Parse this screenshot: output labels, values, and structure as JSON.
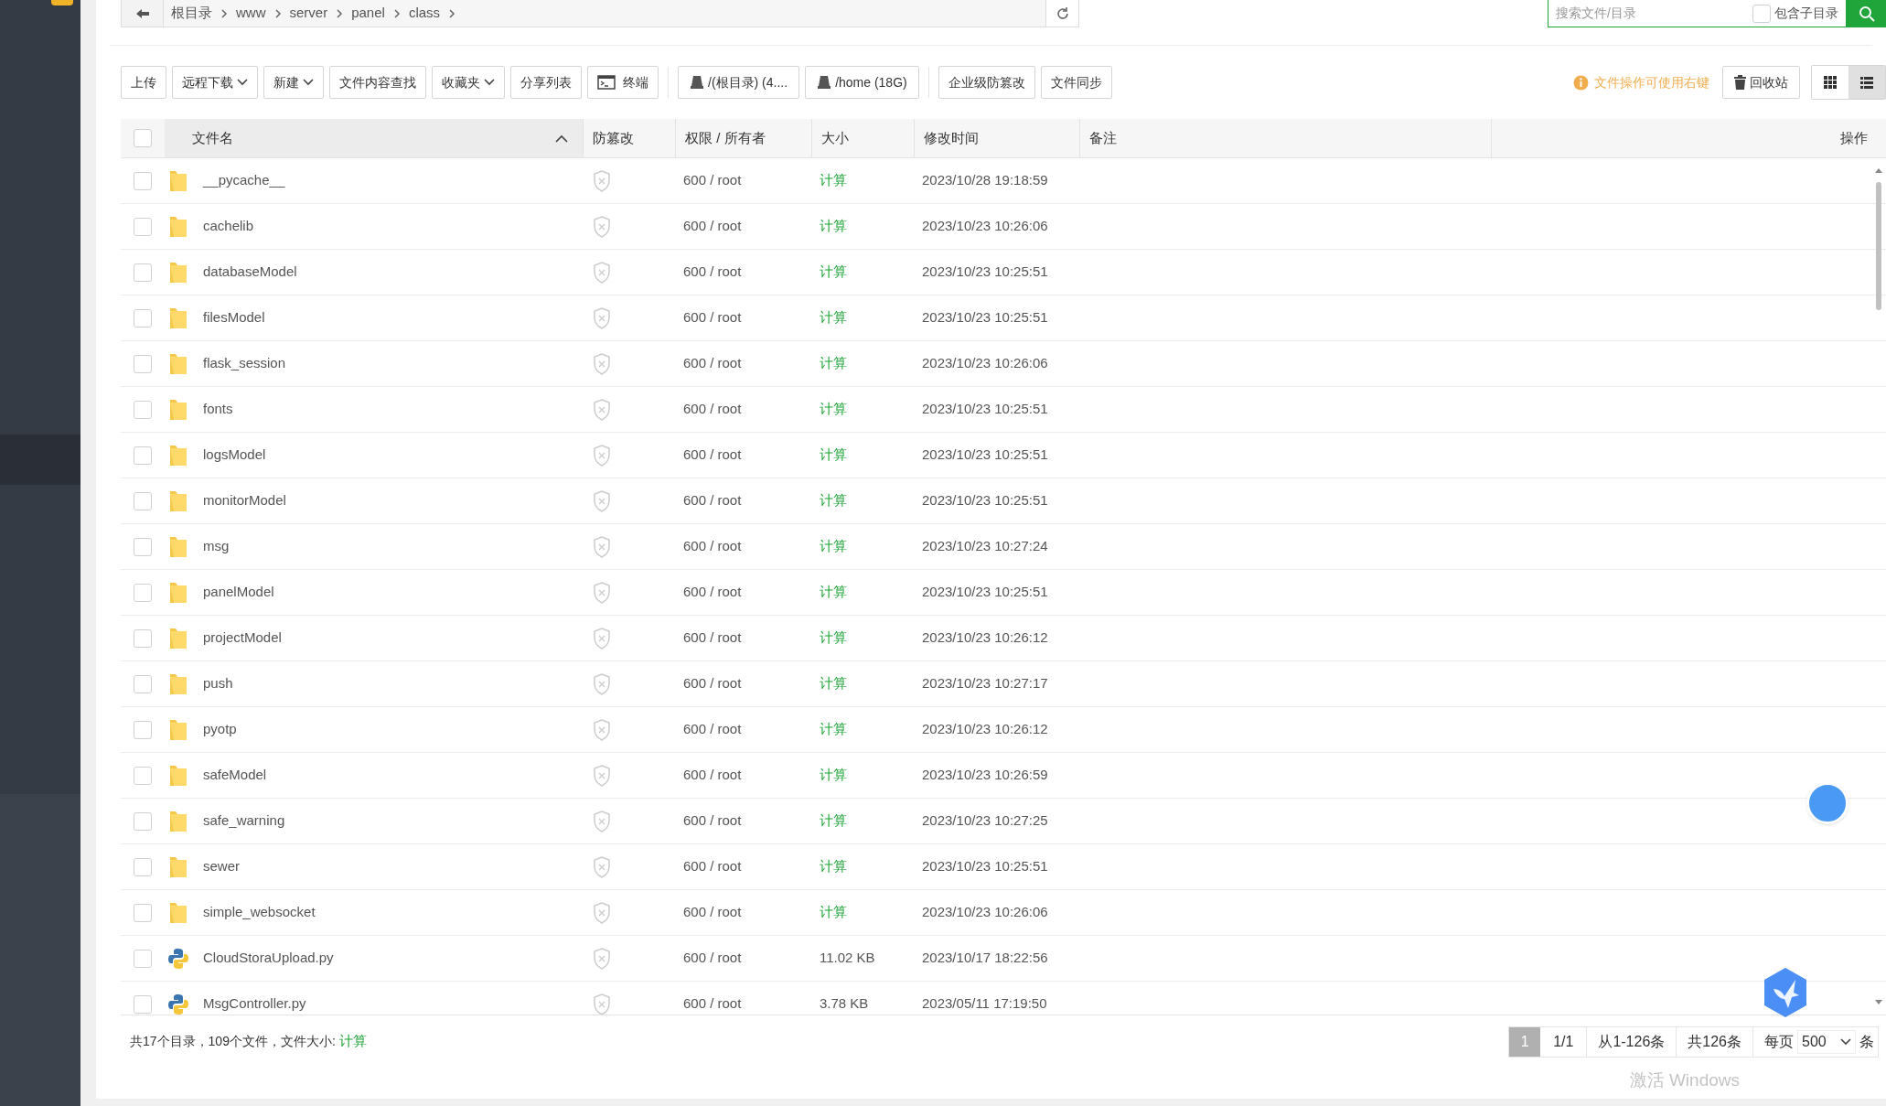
{
  "breadcrumb": [
    "根目录",
    "www",
    "server",
    "panel",
    "class"
  ],
  "search": {
    "placeholder": "搜索文件/目录",
    "include_sub": {
      "label": "包含子目录",
      "checked": false
    }
  },
  "toolbar": [
    {
      "label": "上传",
      "kind": "plain"
    },
    {
      "label": "远程下载",
      "kind": "dropdown"
    },
    {
      "label": "新建",
      "kind": "dropdown"
    },
    {
      "label": "文件内容查找",
      "kind": "plain"
    },
    {
      "label": "收藏夹",
      "kind": "dropdown"
    },
    {
      "label": "分享列表",
      "kind": "plain"
    },
    {
      "label": "终端",
      "kind": "terminal"
    },
    {
      "label": "/(根目录) (4....",
      "kind": "disk"
    },
    {
      "label": "/home (18G)",
      "kind": "disk"
    },
    {
      "label": "企业级防篡改",
      "kind": "plain"
    },
    {
      "label": "文件同步",
      "kind": "plain"
    }
  ],
  "hint": "文件操作可使用右键",
  "recycle": "回收站",
  "views": [
    {
      "kind": "grid",
      "selected": false
    },
    {
      "kind": "list",
      "selected": true
    }
  ],
  "table": {
    "select_all_checked": false,
    "columns": [
      "文件名",
      "防篡改",
      "权限 / 所有者",
      "大小",
      "修改时间",
      "备注",
      "操作"
    ],
    "rows": [
      {
        "name": "__pycache__",
        "kind": "folder",
        "checked": false,
        "perm": "600 / root",
        "size": "计算",
        "mtime": "2023/10/28 19:18:59"
      },
      {
        "name": "cachelib",
        "kind": "folder",
        "checked": false,
        "perm": "600 / root",
        "size": "计算",
        "mtime": "2023/10/23 10:26:06"
      },
      {
        "name": "databaseModel",
        "kind": "folder",
        "checked": false,
        "perm": "600 / root",
        "size": "计算",
        "mtime": "2023/10/23 10:25:51"
      },
      {
        "name": "filesModel",
        "kind": "folder",
        "checked": false,
        "perm": "600 / root",
        "size": "计算",
        "mtime": "2023/10/23 10:25:51"
      },
      {
        "name": "flask_session",
        "kind": "folder",
        "checked": false,
        "perm": "600 / root",
        "size": "计算",
        "mtime": "2023/10/23 10:26:06"
      },
      {
        "name": "fonts",
        "kind": "folder",
        "checked": false,
        "perm": "600 / root",
        "size": "计算",
        "mtime": "2023/10/23 10:25:51"
      },
      {
        "name": "logsModel",
        "kind": "folder",
        "checked": false,
        "perm": "600 / root",
        "size": "计算",
        "mtime": "2023/10/23 10:25:51"
      },
      {
        "name": "monitorModel",
        "kind": "folder",
        "checked": false,
        "perm": "600 / root",
        "size": "计算",
        "mtime": "2023/10/23 10:25:51"
      },
      {
        "name": "msg",
        "kind": "folder",
        "checked": false,
        "perm": "600 / root",
        "size": "计算",
        "mtime": "2023/10/23 10:27:24"
      },
      {
        "name": "panelModel",
        "kind": "folder",
        "checked": false,
        "perm": "600 / root",
        "size": "计算",
        "mtime": "2023/10/23 10:25:51"
      },
      {
        "name": "projectModel",
        "kind": "folder",
        "checked": false,
        "perm": "600 / root",
        "size": "计算",
        "mtime": "2023/10/23 10:26:12"
      },
      {
        "name": "push",
        "kind": "folder",
        "checked": false,
        "perm": "600 / root",
        "size": "计算",
        "mtime": "2023/10/23 10:27:17"
      },
      {
        "name": "pyotp",
        "kind": "folder",
        "checked": false,
        "perm": "600 / root",
        "size": "计算",
        "mtime": "2023/10/23 10:26:12"
      },
      {
        "name": "safeModel",
        "kind": "folder",
        "checked": false,
        "perm": "600 / root",
        "size": "计算",
        "mtime": "2023/10/23 10:26:59"
      },
      {
        "name": "safe_warning",
        "kind": "folder",
        "checked": false,
        "perm": "600 / root",
        "size": "计算",
        "mtime": "2023/10/23 10:27:25"
      },
      {
        "name": "sewer",
        "kind": "folder",
        "checked": false,
        "perm": "600 / root",
        "size": "计算",
        "mtime": "2023/10/23 10:25:51"
      },
      {
        "name": "simple_websocket",
        "kind": "folder",
        "checked": false,
        "perm": "600 / root",
        "size": "计算",
        "mtime": "2023/10/23 10:26:06"
      },
      {
        "name": "CloudStoraUpload.py",
        "kind": "python",
        "checked": false,
        "perm": "600 / root",
        "size": "11.02 KB",
        "mtime": "2023/10/17 18:22:56"
      },
      {
        "name": "MsgController.py",
        "kind": "python",
        "checked": false,
        "perm": "600 / root",
        "size": "3.78 KB",
        "mtime": "2023/05/11 17:19:50"
      }
    ]
  },
  "footer": {
    "summary": "共17个目录，109个文件，文件大小:",
    "size_link": "计算"
  },
  "pagination": {
    "pages": [
      {
        "label": "1",
        "selected": true
      }
    ],
    "page_of": "1/1",
    "range": "从1-126条",
    "total": "共126条",
    "per_page_label": "每页",
    "per_page": "500",
    "unit": "条"
  },
  "os_notice": "激活 Windows"
}
